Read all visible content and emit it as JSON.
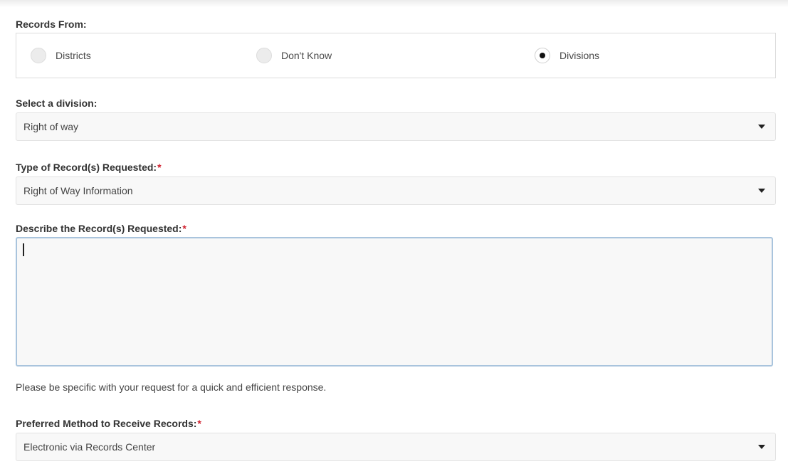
{
  "records_from": {
    "label": "Records From:",
    "options": [
      {
        "label": "Districts",
        "selected": false
      },
      {
        "label": "Don't Know",
        "selected": false
      },
      {
        "label": "Divisions",
        "selected": true
      }
    ]
  },
  "division": {
    "label": "Select a division:",
    "value": "Right of way",
    "icon": "caret-down-icon"
  },
  "record_type": {
    "label": "Type of Record(s) Requested:",
    "required_marker": "*",
    "value": "Right of Way Information",
    "icon": "caret-down-icon"
  },
  "describe": {
    "label": "Describe the Record(s) Requested:",
    "required_marker": "*",
    "value": "",
    "help_text": "Please be specific with your request for a quick and efficient response."
  },
  "preferred_method": {
    "label": "Preferred Method to Receive Records:",
    "required_marker": "*",
    "value": "Electronic via Records Center",
    "icon": "caret-down-icon"
  },
  "colors": {
    "required": "#d0202e",
    "focus_border": "#a9c4dd",
    "field_background": "#f8f8f8",
    "border": "#dcdcdc"
  }
}
